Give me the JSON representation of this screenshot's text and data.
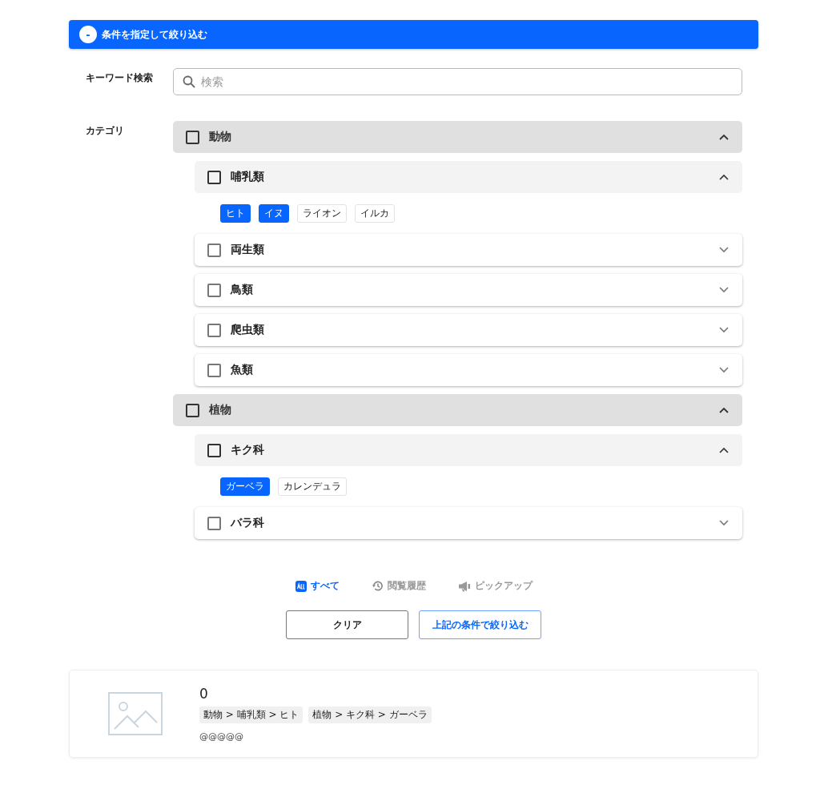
{
  "filter_header": {
    "toggle": "-",
    "title": "条件を指定して絞り込む",
    "expanded": true
  },
  "keyword": {
    "label": "キーワード検索",
    "placeholder": "検索"
  },
  "category": {
    "label": "カテゴリ",
    "items": [
      {
        "label": "動物",
        "checked": false,
        "expanded": true,
        "children": [
          {
            "label": "哺乳類",
            "checked": false,
            "expanded": true,
            "tags": [
              {
                "label": "ヒト",
                "selected": true
              },
              {
                "label": "イヌ",
                "selected": true
              },
              {
                "label": "ライオン",
                "selected": false
              },
              {
                "label": "イルカ",
                "selected": false
              }
            ]
          },
          {
            "label": "両生類",
            "checked": false,
            "expanded": false
          },
          {
            "label": "鳥類",
            "checked": false,
            "expanded": false
          },
          {
            "label": "爬虫類",
            "checked": false,
            "expanded": false
          },
          {
            "label": "魚類",
            "checked": false,
            "expanded": false
          }
        ]
      },
      {
        "label": "植物",
        "checked": false,
        "expanded": true,
        "children": [
          {
            "label": "キク科",
            "checked": false,
            "expanded": true,
            "tags": [
              {
                "label": "ガーベラ",
                "selected": true
              },
              {
                "label": "カレンデュラ",
                "selected": false
              }
            ]
          },
          {
            "label": "バラ科",
            "checked": false,
            "expanded": false
          }
        ]
      }
    ]
  },
  "tabs": [
    {
      "kind": "all",
      "label": "すべて",
      "selected": true
    },
    {
      "kind": "history",
      "label": "閲覧履歴",
      "selected": false
    },
    {
      "kind": "pickup",
      "label": "ピックアップ",
      "selected": false
    }
  ],
  "buttons": {
    "clear": "クリア",
    "apply": "上記の条件で絞り込む"
  },
  "results": [
    {
      "title": "0",
      "paths": [
        "動物 > 哺乳類 > ヒト",
        "植物 > キク科 > ガーベラ"
      ],
      "note": "@@@@@"
    }
  ]
}
